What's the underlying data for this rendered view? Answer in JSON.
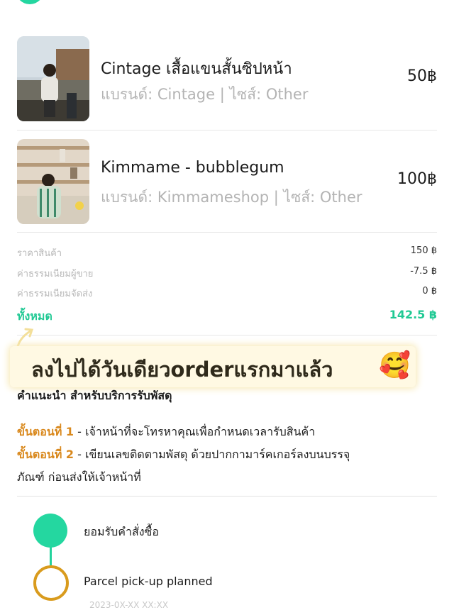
{
  "items": [
    {
      "title": "Cintage เสื้อแขนสั้นซิปหน้า",
      "subtitle": "แบรนด์: Cintage | ไซส์: Other",
      "price": "50฿"
    },
    {
      "title": "Kimmame - bubblegum",
      "subtitle": "แบรนด์: Kimmameshop | ไซส์: Other",
      "price": "100฿"
    }
  ],
  "summary": {
    "product_price_label": "ราคาสินค้า",
    "product_price": "150 ฿",
    "seller_fee_label": "ค่าธรรมเนียมผู้ขาย",
    "seller_fee": "-7.5 ฿",
    "shipping_fee_label": "ค่าธรรมเนียมจัดส่ง",
    "shipping_fee": "0 ฿",
    "total_label": "ทั้งหมด",
    "total": "142.5 ฿"
  },
  "overlay": {
    "text": "ลงไปได้วันเดียวorderแรกมาแล้ว",
    "emoji": "🥰"
  },
  "tips": {
    "title": "คำแนะนำ สำหรับบริการรับพัสดุ",
    "step1_num": "ขั้นตอนที่ 1",
    "step1_text": " - เจ้าหน้าที่จะโทรหาคุณเพื่อกำหนดเวลารับสินค้า",
    "step2_num": "ขั้นตอนที่ 2",
    "step2_text": " - เขียนเลขติดตามพัสดุ ด้วยปากกามาร์คเกอร์ลงบนบรรจุ",
    "step2_cont": "ภัณฑ์ ก่อนส่งให้เจ้าหน้าที่"
  },
  "timeline": {
    "step1": "ยอมรับคำสั่งซื้อ",
    "step2": "Parcel pick-up planned",
    "step2_date": "2023-0X-XX XX:XX"
  },
  "colors": {
    "accent": "#24d6a0",
    "step_orange": "#d9881c",
    "ring": "#d99b1d"
  }
}
